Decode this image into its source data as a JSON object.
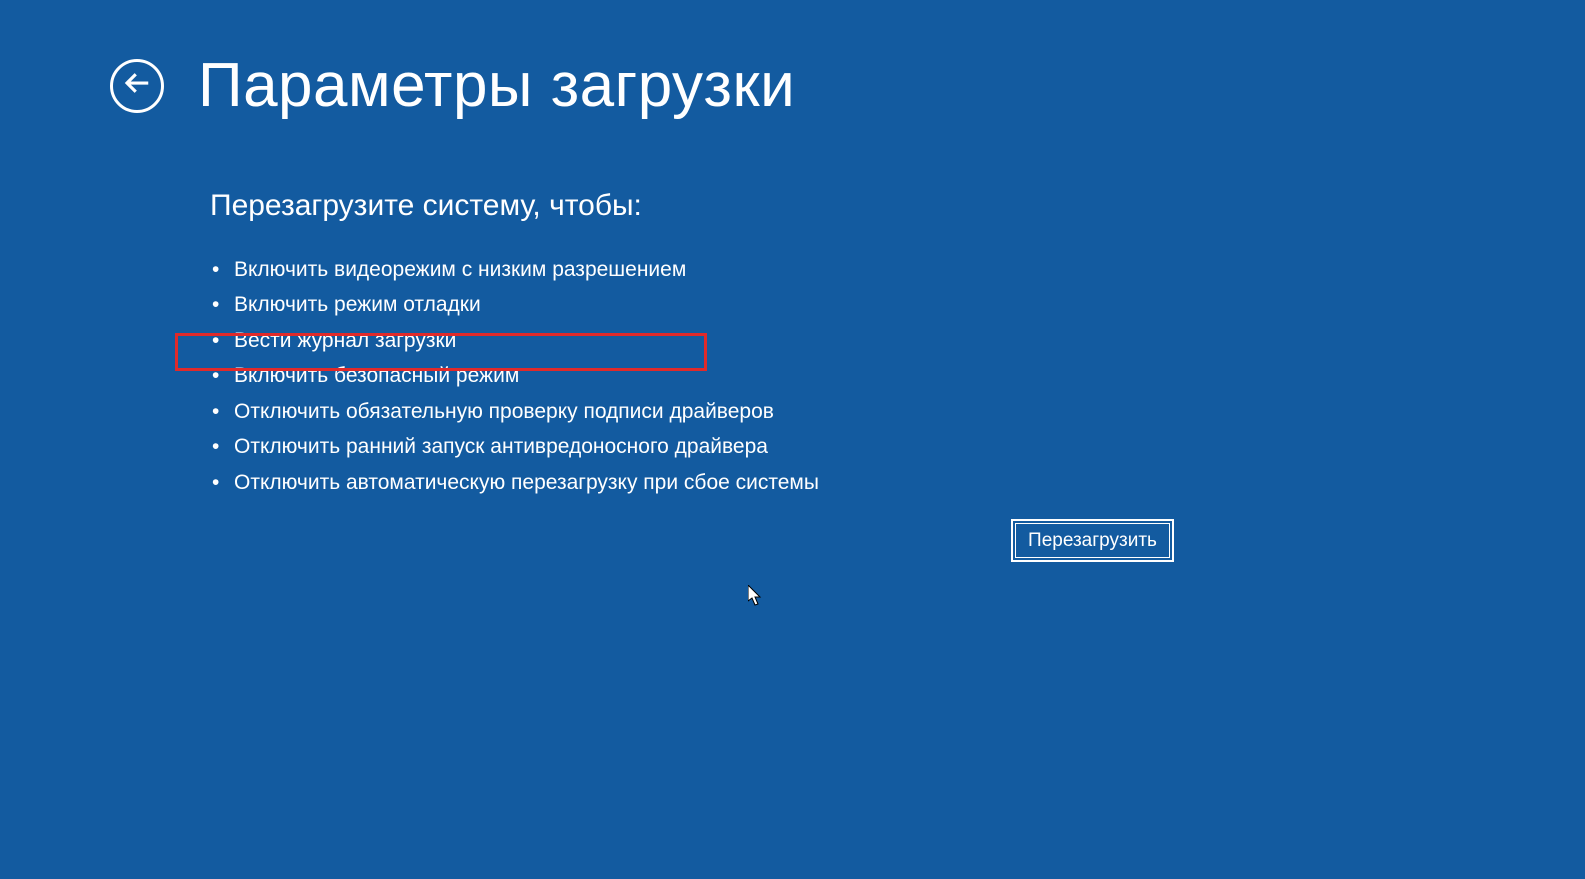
{
  "header": {
    "title": "Параметры загрузки"
  },
  "content": {
    "subtitle": "Перезагрузите систему, чтобы:",
    "options": [
      "Включить видеорежим с низким разрешением",
      "Включить режим отладки",
      "Вести журнал загрузки",
      "Включить безопасный режим",
      "Отключить обязательную проверку подписи драйверов",
      "Отключить ранний запуск антивредоносного драйвера",
      "Отключить автоматическую перезагрузку при сбое системы"
    ]
  },
  "actions": {
    "restart_label": "Перезагрузить"
  },
  "highlighted_index": 3
}
